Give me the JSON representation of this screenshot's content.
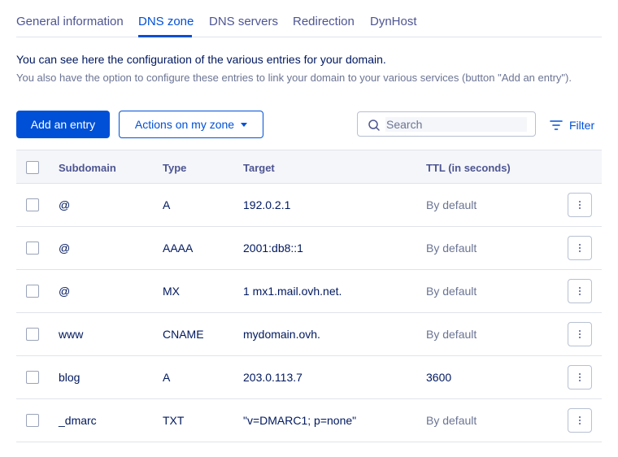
{
  "tabs": [
    {
      "label": "General information",
      "active": false
    },
    {
      "label": "DNS zone",
      "active": true
    },
    {
      "label": "DNS servers",
      "active": false
    },
    {
      "label": "Redirection",
      "active": false
    },
    {
      "label": "DynHost",
      "active": false
    }
  ],
  "intro": {
    "line1": "You can see here the configuration of the various entries for your domain.",
    "line2": "You also have the option to configure these entries to link your domain to your various services (button \"Add an entry\")."
  },
  "toolbar": {
    "add_label": "Add an entry",
    "actions_label": "Actions on my zone",
    "search_placeholder": "Search",
    "search_value": "",
    "filter_label": "Filter"
  },
  "table": {
    "headers": [
      "Subdomain",
      "Type",
      "Target",
      "TTL (in seconds)"
    ],
    "rows": [
      {
        "subdomain": "@",
        "type": "A",
        "target": "192.0.2.1",
        "ttl": "By default"
      },
      {
        "subdomain": "@",
        "type": "AAAA",
        "target": "2001:db8::1",
        "ttl": "By default"
      },
      {
        "subdomain": "@",
        "type": "MX",
        "target": "1 mx1.mail.ovh.net.",
        "ttl": "By default"
      },
      {
        "subdomain": "www",
        "type": "CNAME",
        "target": "mydomain.ovh.",
        "ttl": "By default"
      },
      {
        "subdomain": "blog",
        "type": "A",
        "target": "203.0.113.7",
        "ttl": "3600"
      },
      {
        "subdomain": "_dmarc",
        "type": "TXT",
        "target": "\"v=DMARC1; p=none\"",
        "ttl": "By default"
      }
    ]
  },
  "colors": {
    "primary": "#0050d7",
    "text_dark": "#00185e",
    "text_muted": "#6b7494",
    "header_bg": "#f5f6f9",
    "border": "#dfe3ea"
  },
  "icons": {
    "search": "search-icon",
    "filter": "filter-icon",
    "actions_caret": "caret-down-icon",
    "row_menu": "kebab-menu-icon"
  }
}
